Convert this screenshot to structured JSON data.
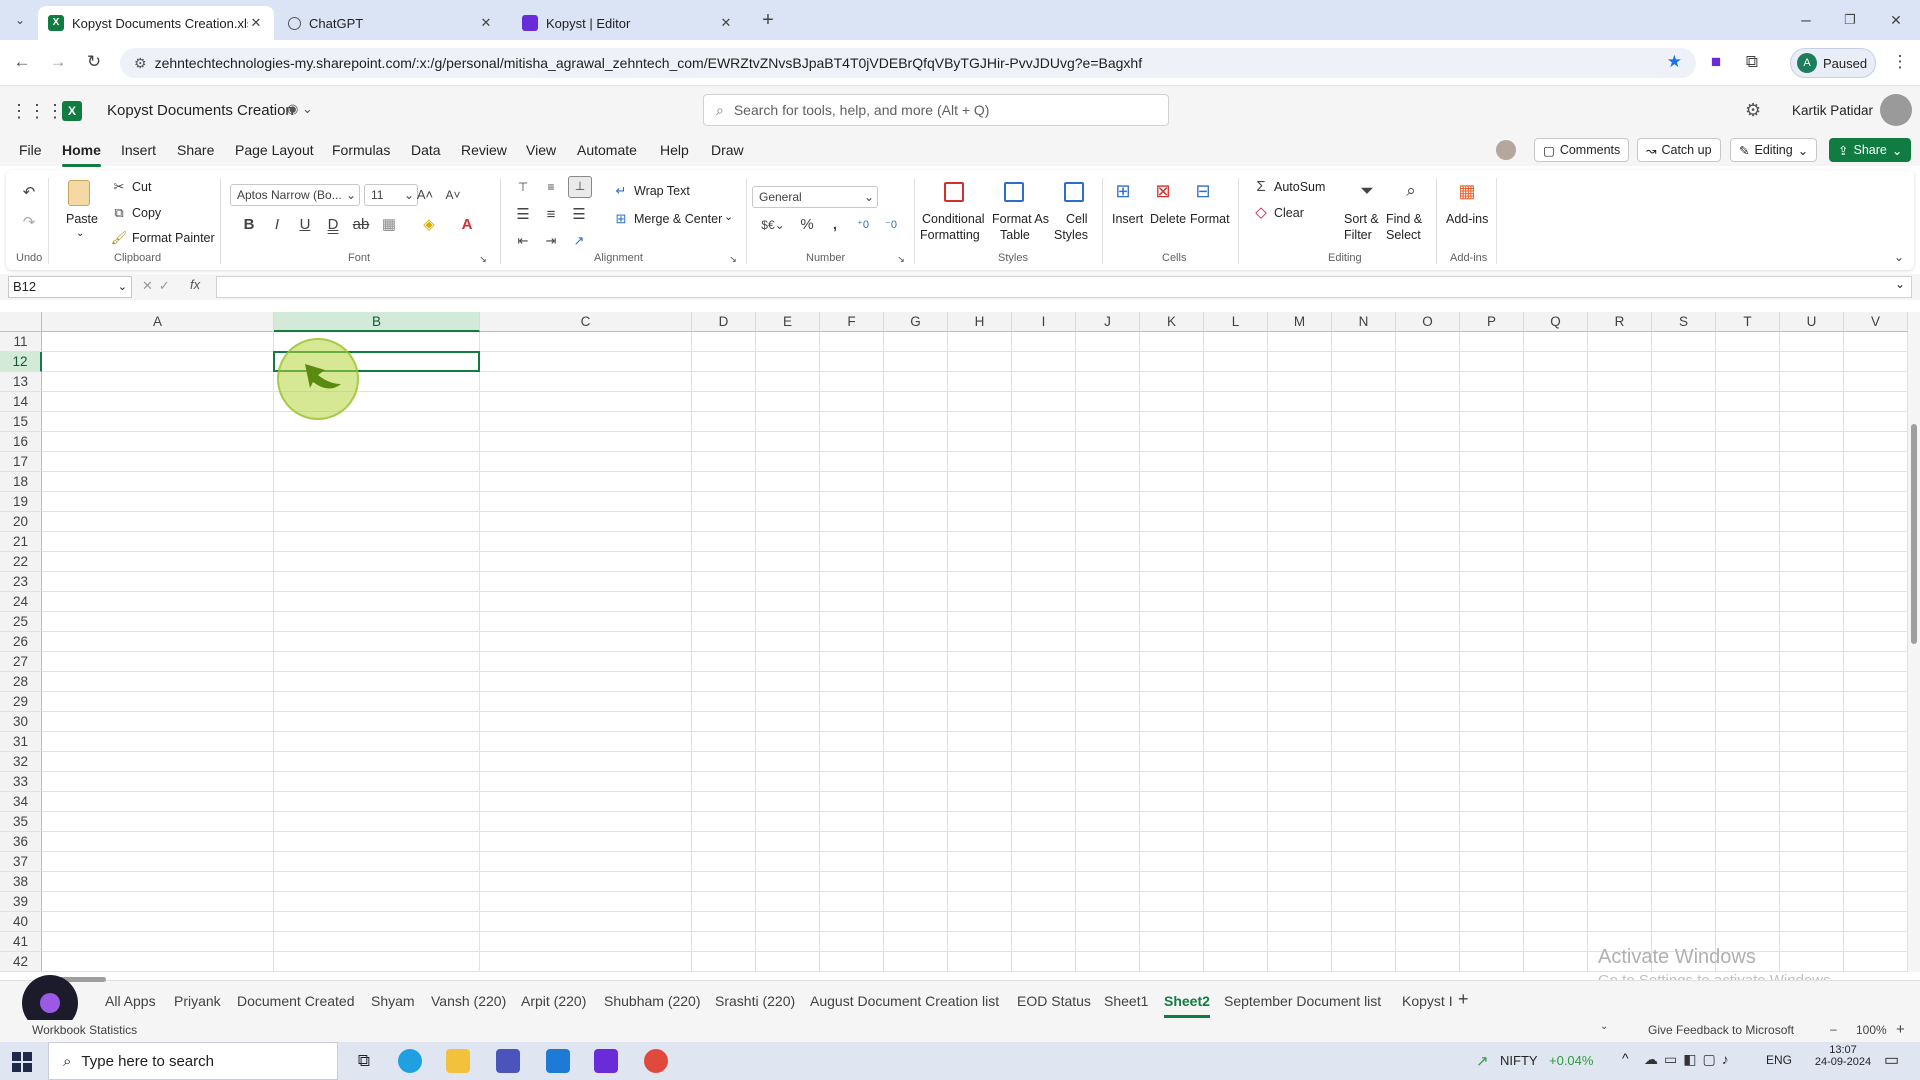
{
  "browser": {
    "tabs": [
      {
        "title": "Kopyst Documents Creation.xlsx",
        "active": true
      },
      {
        "title": "ChatGPT",
        "active": false
      },
      {
        "title": "Kopyst | Editor",
        "active": false
      }
    ],
    "url": "zehntechtechnologies-my.sharepoint.com/:x:/g/personal/mitisha_agrawal_zehntech_com/EWRZtvZNvsBJpaBT4T0jVDEBrQfqVByTGJHir-PvvJDUvg?e=Bagxhf",
    "profile_label": "Paused",
    "profile_initial": "A"
  },
  "app": {
    "doc_title": "Kopyst Documents Creation",
    "search_placeholder": "Search for tools, help, and more (Alt + Q)",
    "user_name": "Kartik Patidar"
  },
  "menu": {
    "items": [
      "File",
      "Home",
      "Insert",
      "Share",
      "Page Layout",
      "Formulas",
      "Data",
      "Review",
      "View",
      "Automate",
      "Help",
      "Draw"
    ],
    "selected": "Home",
    "comments": "Comments",
    "catchup": "Catch up",
    "editing": "Editing",
    "share": "Share"
  },
  "ribbon": {
    "undo_group": "Undo",
    "paste": "Paste",
    "cut": "Cut",
    "copy": "Copy",
    "format_painter": "Format Painter",
    "clipboard_group": "Clipboard",
    "font_name": "Aptos Narrow (Bo...",
    "font_size": "11",
    "font_group": "Font",
    "wrap_text": "Wrap Text",
    "merge_center": "Merge & Center",
    "alignment_group": "Alignment",
    "number_format": "General",
    "number_group": "Number",
    "conditional_formatting_1": "Conditional",
    "conditional_formatting_2": "Formatting",
    "format_as_table_1": "Format As",
    "format_as_table_2": "Table",
    "cell_styles_1": "Cell",
    "cell_styles_2": "Styles",
    "styles_group": "Styles",
    "insert": "Insert",
    "delete": "Delete",
    "format": "Format",
    "cells_group": "Cells",
    "autosum": "AutoSum",
    "clear": "Clear",
    "sort_filter_1": "Sort &",
    "sort_filter_2": "Filter",
    "find_select_1": "Find &",
    "find_select_2": "Select",
    "editing_group": "Editing",
    "addins": "Add-ins",
    "addins_group": "Add-ins"
  },
  "formula_bar": {
    "name_box": "B12",
    "formula": ""
  },
  "grid": {
    "columns": [
      "A",
      "B",
      "C",
      "D",
      "E",
      "F",
      "G",
      "H",
      "I",
      "J",
      "K",
      "L",
      "M",
      "N",
      "O",
      "P",
      "Q",
      "R",
      "S",
      "T",
      "U",
      "V"
    ],
    "rows": [
      "11",
      "12",
      "13",
      "14",
      "15",
      "16",
      "17",
      "18",
      "19",
      "20",
      "21",
      "22",
      "23",
      "24",
      "25",
      "26",
      "27",
      "28",
      "29",
      "30",
      "31",
      "32",
      "33",
      "34",
      "35",
      "36",
      "37",
      "38",
      "39",
      "40",
      "41",
      "42"
    ],
    "selected_cell": "B12"
  },
  "sheets": {
    "tabs": [
      "All Apps",
      "Priyank",
      "Document Created",
      "Shyam",
      "Vansh (220)",
      "Arpit (220)",
      "Shubham (220)",
      "Srashti (220)",
      "August Document Creation list",
      "EOD Status",
      "Sheet1",
      "Sheet2",
      "September Document list",
      "Kopyst I"
    ],
    "selected": "Sheet2"
  },
  "status": {
    "left": "Workbook Statistics",
    "feedback": "Give Feedback to Microsoft",
    "zoom": "100%"
  },
  "watermark": {
    "line1": "Activate Windows",
    "line2": "Go to Settings to activate Windows."
  },
  "taskbar": {
    "search_placeholder": "Type here to search",
    "stock_name": "NIFTY",
    "stock_change": "+0.04%",
    "lang": "ENG",
    "time": "13:07",
    "date": "24-09-2024"
  },
  "colors": {
    "accent": "#107c41",
    "selection": "#d3ead9",
    "tabbar": "#dbe4f4"
  }
}
